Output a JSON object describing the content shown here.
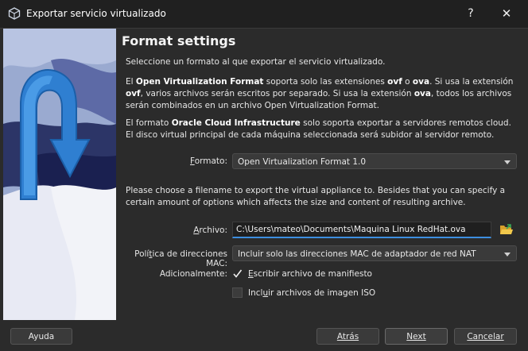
{
  "window": {
    "title": "Exportar servicio virtualizado",
    "help_glyph": "?",
    "close_glyph": "✕"
  },
  "page": {
    "heading": "Format settings",
    "intro": "Seleccione un formato al que exportar el servicio virtualizado.",
    "ovf_pre": "El ",
    "ovf_bold": "Open Virtualization Format",
    "ovf_mid1": " soporta solo las extensiones ",
    "ovf_ext1": "ovf",
    "ovf_mid2": " o ",
    "ovf_ext2": "ova",
    "ovf_mid3": ". Si usa la extensión ",
    "ovf_ext3": "ovf",
    "ovf_mid4": ", varios archivos serán escritos por separado. Si usa la extensión ",
    "ovf_ext4": "ova",
    "ovf_end": ", todos los archivos serán combinados en un archivo Open Virtualization Format.",
    "oci_pre": "El formato ",
    "oci_bold": "Oracle Cloud Infrastructure",
    "oci_end": " solo soporta exportar a servidores remotos cloud. El disco virtual principal de cada máquina seleccionada será subidor al servidor remoto.",
    "filename_info": "Please choose a filename to export the virtual appliance to. Besides that you can specify a certain amount of options which affects the size and content of resulting archive."
  },
  "form": {
    "format_label_u": "F",
    "format_label_rest": "ormato:",
    "format_value": "Open Virtualization Format 1.0",
    "file_label_u": "A",
    "file_label_rest": "rchivo:",
    "file_value": "C:\\Users\\mateo\\Documents\\Maquina Linux RedHat.ova",
    "mac_label_pre": "Polí",
    "mac_label_u": "t",
    "mac_label_rest": "ica de direcciones MAC:",
    "mac_value": "Incluir solo las direcciones MAC de adaptador de red NAT",
    "additional_label": "Adicionalmente:",
    "manifest_u": "E",
    "manifest_rest": "scribir archivo de manifiesto",
    "manifest_checked": true,
    "iso_pre": "Incl",
    "iso_u": "u",
    "iso_rest": "ir archivos de imagen ISO",
    "iso_checked": false
  },
  "buttons": {
    "help": "Ayuda",
    "back": "Atrás",
    "next": "Next",
    "cancel": "Cancelar"
  },
  "icons": {
    "app": "virtualbox-icon",
    "folder": "folder-open-icon",
    "banner": "export-arrow-illustration"
  }
}
